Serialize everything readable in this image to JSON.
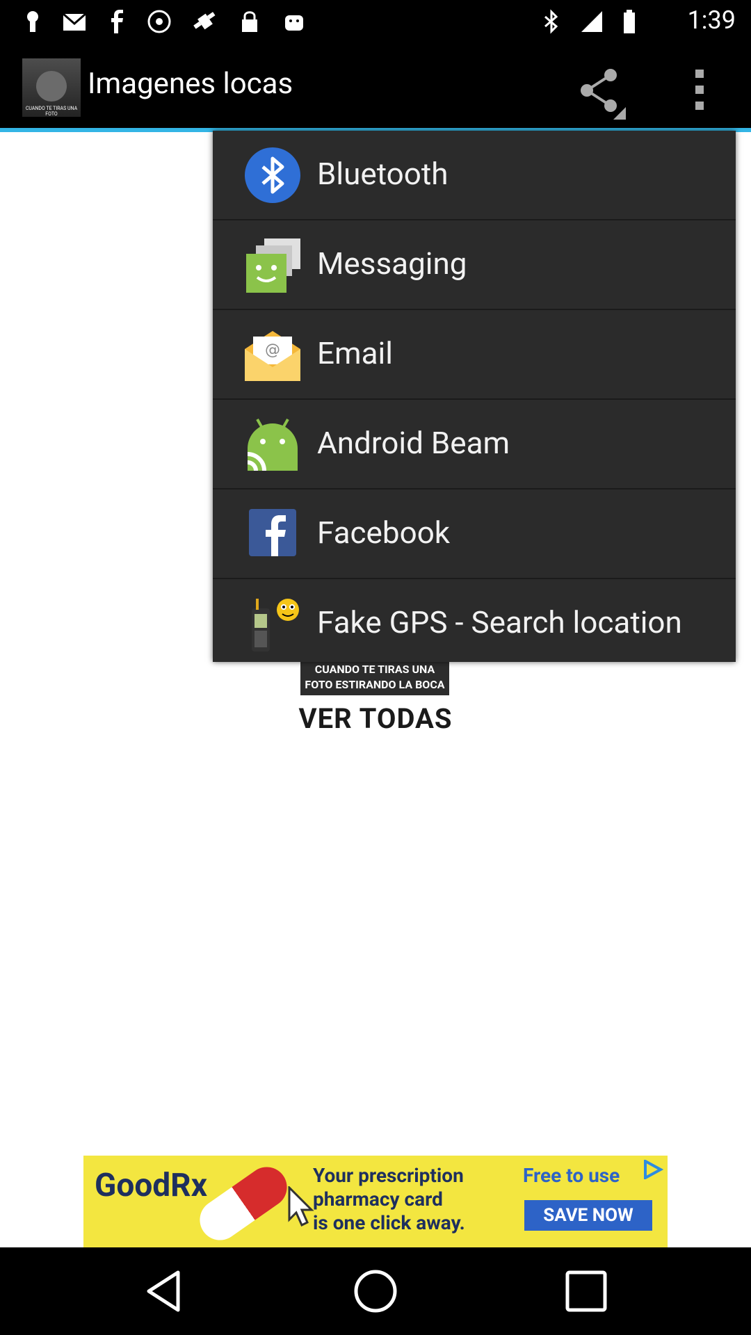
{
  "status_bar": {
    "time": "1:39",
    "icons": [
      "keyhole-icon",
      "notification-mail-icon",
      "facebook-icon",
      "no-disturb-icon",
      "fake-gps-icon",
      "lock-icon",
      "android-icon",
      "bluetooth-icon",
      "signal-icon",
      "battery-icon"
    ]
  },
  "action_bar": {
    "title": "Imagenes locas",
    "thumb_caption": "CUANDO TE TIRAS UNA FOTO",
    "share_icon": "share-icon",
    "overflow_icon": "overflow-menu-icon",
    "accent_color": "#33b5e5"
  },
  "content": {
    "meme_caption": "CUANDO TE TIRAS UNA FOTO ESTIRANDO LA BOCA",
    "ver_todas": "VER TODAS"
  },
  "share_menu": {
    "items": [
      {
        "label": "Bluetooth",
        "icon": "bluetooth-icon"
      },
      {
        "label": "Messaging",
        "icon": "messaging-icon"
      },
      {
        "label": "Email",
        "icon": "email-icon"
      },
      {
        "label": "Android Beam",
        "icon": "android-beam-icon"
      },
      {
        "label": "Facebook",
        "icon": "facebook-icon"
      },
      {
        "label": "Fake GPS - Search location",
        "icon": "fake-gps-icon"
      }
    ]
  },
  "ad": {
    "brand": "GoodRx",
    "line1": "Your prescription",
    "line2": "pharmacy card",
    "line3": "is one click away.",
    "free": "Free to use",
    "cta": "SAVE NOW"
  },
  "nav_bar": {
    "back_icon": "back-icon",
    "home_icon": "home-icon",
    "recents_icon": "recents-icon"
  }
}
